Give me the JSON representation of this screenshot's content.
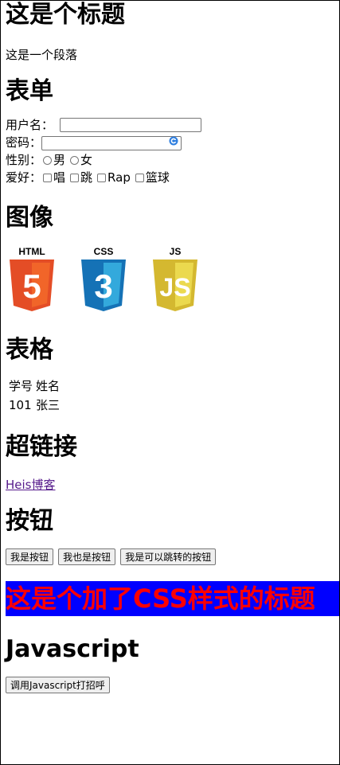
{
  "page": {
    "title": "这是个标题",
    "paragraph": "这是一个段落"
  },
  "form_section": {
    "heading": "表单",
    "username_label": "用户名：",
    "username_value": "",
    "password_label": "密码：",
    "password_value": "",
    "gender_label": "性别：",
    "gender_options": [
      "男",
      "女"
    ],
    "hobby_label": "爱好：",
    "hobby_options": [
      "唱",
      "跳",
      "Rap",
      "篮球"
    ]
  },
  "image_section": {
    "heading": "图像",
    "logos": [
      {
        "icon": "html5-logo",
        "label": "HTML",
        "glyph": "5",
        "color": "#e44d26",
        "shade": "#f16529"
      },
      {
        "icon": "css3-logo",
        "label": "CSS",
        "glyph": "3",
        "color": "#1572b6",
        "shade": "#33a9dc"
      },
      {
        "icon": "js-logo",
        "label": "JS",
        "glyph": "JS",
        "color": "#d4b830",
        "shade": "#ebd94e"
      }
    ]
  },
  "table_section": {
    "heading": "表格",
    "headers": [
      "学号",
      "姓名"
    ],
    "rows": [
      [
        "101",
        "张三"
      ]
    ]
  },
  "link_section": {
    "heading": "超链接",
    "link_text": "Heis博客"
  },
  "button_section": {
    "heading": "按钮",
    "buttons": [
      "我是按钮",
      "我也是按钮",
      "我是可以跳转的按钮"
    ]
  },
  "css_section": {
    "styled_title": "这是个加了CSS样式的标题",
    "background": "#0000ff",
    "color": "#ff0000"
  },
  "js_section": {
    "heading": "Javascript",
    "button_label": "调用Javascript打招呼"
  }
}
